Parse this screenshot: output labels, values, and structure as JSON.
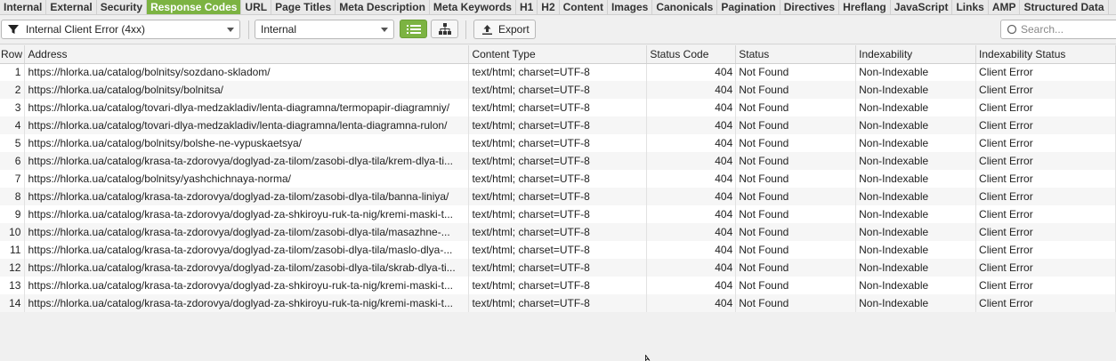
{
  "tabs": [
    {
      "label": "Internal",
      "active": false
    },
    {
      "label": "External",
      "active": false
    },
    {
      "label": "Security",
      "active": false
    },
    {
      "label": "Response Codes",
      "active": true
    },
    {
      "label": "URL",
      "active": false
    },
    {
      "label": "Page Titles",
      "active": false
    },
    {
      "label": "Meta Description",
      "active": false
    },
    {
      "label": "Meta Keywords",
      "active": false
    },
    {
      "label": "H1",
      "active": false
    },
    {
      "label": "H2",
      "active": false
    },
    {
      "label": "Content",
      "active": false
    },
    {
      "label": "Images",
      "active": false
    },
    {
      "label": "Canonicals",
      "active": false
    },
    {
      "label": "Pagination",
      "active": false
    },
    {
      "label": "Directives",
      "active": false
    },
    {
      "label": "Hreflang",
      "active": false
    },
    {
      "label": "JavaScript",
      "active": false
    },
    {
      "label": "Links",
      "active": false
    },
    {
      "label": "AMP",
      "active": false
    },
    {
      "label": "Structured Data",
      "active": false
    }
  ],
  "toolbar": {
    "filter_value": "Internal Client Error (4xx)",
    "scope_value": "Internal",
    "export_label": "Export",
    "search_placeholder": "Search..."
  },
  "colors": {
    "accent": "#7cb342"
  },
  "icons": {
    "filter": "funnel-icon",
    "list_view": "list-view-icon",
    "tree_view": "tree-view-icon",
    "export": "export-icon",
    "search": "search-icon"
  },
  "table": {
    "columns": [
      "Row",
      "Address",
      "Content Type",
      "Status Code",
      "Status",
      "Indexability",
      "Indexability Status"
    ],
    "rows": [
      {
        "row": "1",
        "address": "https://hlorka.ua/catalog/bolnitsy/sozdano-skladom/",
        "content_type": "text/html; charset=UTF-8",
        "status_code": "404",
        "status": "Not Found",
        "indexability": "Non-Indexable",
        "indexability_status": "Client Error"
      },
      {
        "row": "2",
        "address": "https://hlorka.ua/catalog/bolnitsy/bolnitsa/",
        "content_type": "text/html; charset=UTF-8",
        "status_code": "404",
        "status": "Not Found",
        "indexability": "Non-Indexable",
        "indexability_status": "Client Error"
      },
      {
        "row": "3",
        "address": "https://hlorka.ua/catalog/tovari-dlya-medzakladiv/lenta-diagramna/termopapir-diagramniy/",
        "content_type": "text/html; charset=UTF-8",
        "status_code": "404",
        "status": "Not Found",
        "indexability": "Non-Indexable",
        "indexability_status": "Client Error"
      },
      {
        "row": "4",
        "address": "https://hlorka.ua/catalog/tovari-dlya-medzakladiv/lenta-diagramna/lenta-diagramna-rulon/",
        "content_type": "text/html; charset=UTF-8",
        "status_code": "404",
        "status": "Not Found",
        "indexability": "Non-Indexable",
        "indexability_status": "Client Error"
      },
      {
        "row": "5",
        "address": "https://hlorka.ua/catalog/bolnitsy/bolshe-ne-vypuskaetsya/",
        "content_type": "text/html; charset=UTF-8",
        "status_code": "404",
        "status": "Not Found",
        "indexability": "Non-Indexable",
        "indexability_status": "Client Error"
      },
      {
        "row": "6",
        "address": "https://hlorka.ua/catalog/krasa-ta-zdorovya/doglyad-za-tilom/zasobi-dlya-tila/krem-dlya-ti...",
        "content_type": "text/html; charset=UTF-8",
        "status_code": "404",
        "status": "Not Found",
        "indexability": "Non-Indexable",
        "indexability_status": "Client Error"
      },
      {
        "row": "7",
        "address": "https://hlorka.ua/catalog/bolnitsy/yashchichnaya-norma/",
        "content_type": "text/html; charset=UTF-8",
        "status_code": "404",
        "status": "Not Found",
        "indexability": "Non-Indexable",
        "indexability_status": "Client Error"
      },
      {
        "row": "8",
        "address": "https://hlorka.ua/catalog/krasa-ta-zdorovya/doglyad-za-tilom/zasobi-dlya-tila/banna-liniya/",
        "content_type": "text/html; charset=UTF-8",
        "status_code": "404",
        "status": "Not Found",
        "indexability": "Non-Indexable",
        "indexability_status": "Client Error"
      },
      {
        "row": "9",
        "address": "https://hlorka.ua/catalog/krasa-ta-zdorovya/doglyad-za-shkiroyu-ruk-ta-nig/kremi-maski-t...",
        "content_type": "text/html; charset=UTF-8",
        "status_code": "404",
        "status": "Not Found",
        "indexability": "Non-Indexable",
        "indexability_status": "Client Error"
      },
      {
        "row": "10",
        "address": "https://hlorka.ua/catalog/krasa-ta-zdorovya/doglyad-za-tilom/zasobi-dlya-tila/masazhne-...",
        "content_type": "text/html; charset=UTF-8",
        "status_code": "404",
        "status": "Not Found",
        "indexability": "Non-Indexable",
        "indexability_status": "Client Error"
      },
      {
        "row": "11",
        "address": "https://hlorka.ua/catalog/krasa-ta-zdorovya/doglyad-za-tilom/zasobi-dlya-tila/maslo-dlya-...",
        "content_type": "text/html; charset=UTF-8",
        "status_code": "404",
        "status": "Not Found",
        "indexability": "Non-Indexable",
        "indexability_status": "Client Error"
      },
      {
        "row": "12",
        "address": "https://hlorka.ua/catalog/krasa-ta-zdorovya/doglyad-za-tilom/zasobi-dlya-tila/skrab-dlya-ti...",
        "content_type": "text/html; charset=UTF-8",
        "status_code": "404",
        "status": "Not Found",
        "indexability": "Non-Indexable",
        "indexability_status": "Client Error"
      },
      {
        "row": "13",
        "address": "https://hlorka.ua/catalog/krasa-ta-zdorovya/doglyad-za-shkiroyu-ruk-ta-nig/kremi-maski-t...",
        "content_type": "text/html; charset=UTF-8",
        "status_code": "404",
        "status": "Not Found",
        "indexability": "Non-Indexable",
        "indexability_status": "Client Error"
      },
      {
        "row": "14",
        "address": "https://hlorka.ua/catalog/krasa-ta-zdorovya/doglyad-za-shkiroyu-ruk-ta-nig/kremi-maski-t...",
        "content_type": "text/html; charset=UTF-8",
        "status_code": "404",
        "status": "Not Found",
        "indexability": "Non-Indexable",
        "indexability_status": "Client Error"
      }
    ]
  }
}
